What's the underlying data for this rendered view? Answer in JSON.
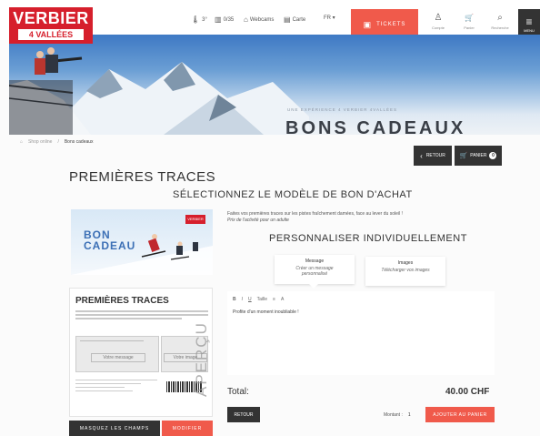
{
  "brand": {
    "name": "VERBIER",
    "sub": "4 VALLÉES"
  },
  "topnav": [
    {
      "icon": "thermometer-icon",
      "glyph": "🌡",
      "label": "3°"
    },
    {
      "icon": "lift-icon",
      "glyph": "▥",
      "label": "0/35"
    },
    {
      "icon": "webcam-icon",
      "glyph": "⌂",
      "label": "Webcams"
    },
    {
      "icon": "map-icon",
      "glyph": "▤",
      "label": "Carte"
    }
  ],
  "lang": "FR ▾",
  "tickets_label": "TICKETS",
  "user_icons": [
    {
      "icon": "user-icon",
      "glyph": "♙",
      "label": "Compte"
    },
    {
      "icon": "cart-icon",
      "glyph": "🛒",
      "label": "Panier"
    },
    {
      "icon": "search-icon",
      "glyph": "⌕",
      "label": "Recherche"
    }
  ],
  "menu_label": "MENU",
  "hero": {
    "subtitle": "UNE EXPÉRIENCE 4 VERBIER 4VALLÉES",
    "title": "BONS CADEAUX"
  },
  "breadcrumb": {
    "home": "⌂",
    "items": [
      "Shop online",
      "Bons cadeaux"
    ]
  },
  "retour_top": "RETOUR",
  "panier": {
    "label": "PANIER",
    "count": "0"
  },
  "page_title": "PREMIÈRES TRACES",
  "section_title": "SÉLECTIONNEZ LE MODÈLE DE BON D'ACHAT",
  "card": {
    "bon": "BON",
    "cadeau": "CADEAU"
  },
  "doc": {
    "title": "PREMIÈRES TRACES",
    "msg_label": "Votre message",
    "img_label": "Votre image"
  },
  "apercu": "APERÇU",
  "masquer_label": "MASQUEZ LES CHAMPS",
  "modif_label": "MODIFIER",
  "description": {
    "line1": "Faites vos premières traces sur les pistes fraîchement damées, face au lever du soleil !",
    "line2": "Prix de l'activité pour un adulte"
  },
  "personnaliser": "PERSONNALISER INDIVIDUELLEMENT",
  "tabs": {
    "message": {
      "title": "Message",
      "sub1": "Créer un message",
      "sub2": "personnalisé"
    },
    "images": {
      "title": "Images",
      "sub1": "Télécharger vos images"
    }
  },
  "toolbar": [
    "B",
    "I",
    "U",
    "Taille",
    "≡",
    "A"
  ],
  "editor_text": "Profite d'un moment inoubliable !",
  "total_label": "Total:",
  "total_value": "40.00 CHF",
  "retour_label": "RETOUR",
  "montant_label": "Montant :",
  "montant_value": "1",
  "add_label": "AJOUTER AU PANIER"
}
